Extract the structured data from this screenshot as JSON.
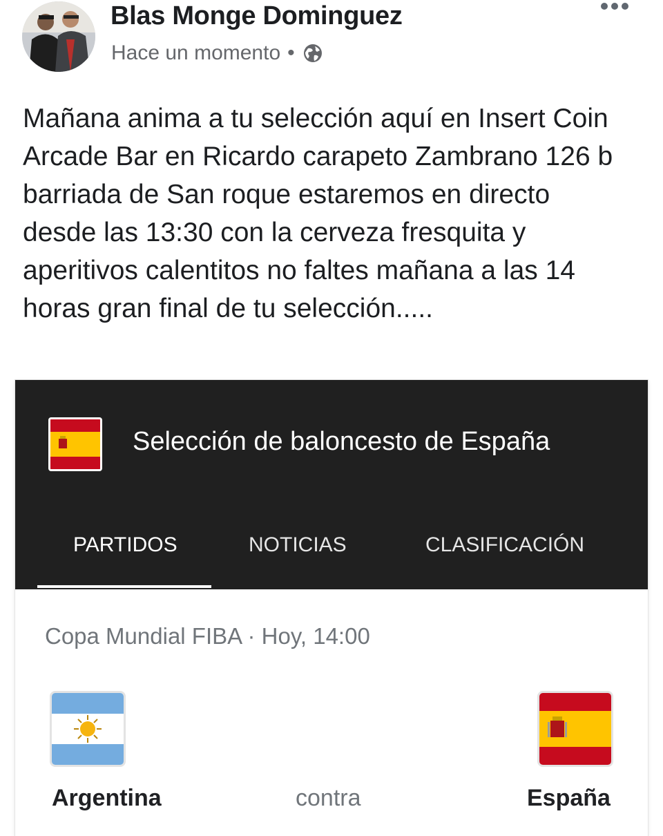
{
  "post": {
    "author": "Blas Monge Dominguez",
    "timestamp": "Hace un momento",
    "separator": "•",
    "privacy_icon": "globe-icon",
    "more_icon": "more-horizontal-icon",
    "text": "Mañana anima a tu selección aquí en Insert Coin Arcade Bar en Ricardo carapeto Zambrano 126 b barriada de San roque estaremos en directo desde las 13:30 con la cerveza fresquita y aperitivos calentitos no faltes mañana a las 14 horas gran final de tu selección....."
  },
  "card": {
    "title": "Selección de baloncesto de España",
    "tabs": [
      {
        "label": "PARTIDOS",
        "active": true
      },
      {
        "label": "NOTICIAS",
        "active": false
      },
      {
        "label": "CLASIFICACIÓN",
        "active": false
      }
    ],
    "match": {
      "competition_and_time": "Copa Mundial FIBA · Hoy, 14:00",
      "home_team": "Argentina",
      "away_team": "España",
      "versus": "contra"
    }
  },
  "colors": {
    "card_header_bg": "#202020",
    "secondary_text": "#65676b",
    "spain_red": "#c60b1e",
    "spain_yellow": "#ffc400",
    "argentina_blue": "#74acdf",
    "argentina_sun": "#f6b40e"
  }
}
